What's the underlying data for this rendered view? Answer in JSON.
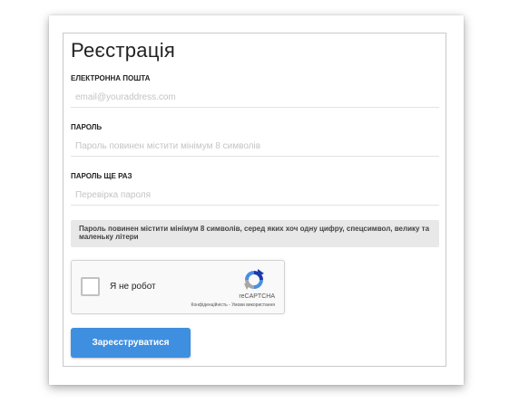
{
  "form": {
    "title": "Реєстрація",
    "email": {
      "label": "ЕЛЕКТРОННА ПОШТА",
      "placeholder": "email@youraddress.com",
      "value": ""
    },
    "password": {
      "label": "ПАРОЛЬ",
      "placeholder": "Пароль повинен містити мінімум 8 символів",
      "value": ""
    },
    "password_repeat": {
      "label": "ПАРОЛЬ ЩЕ РАЗ",
      "placeholder": "Перевірка пароля",
      "value": ""
    },
    "hint": "Пароль повинен містити мінімум 8 символів, серед яких хоч одну цифру, спецсимвол, велику та маленьку літери",
    "captcha": {
      "label": "Я не робот",
      "brand": "reCAPTCHA",
      "privacy_link": "Конфіденційність",
      "separator": " - ",
      "terms_link": "Умови використання",
      "checked": false,
      "icon": "recaptcha-logo-icon"
    },
    "submit_label": "Зареєструватися"
  },
  "colors": {
    "accent": "#3f8fe0",
    "hint_background": "#e8e8e8",
    "placeholder": "#c4c4c4"
  }
}
